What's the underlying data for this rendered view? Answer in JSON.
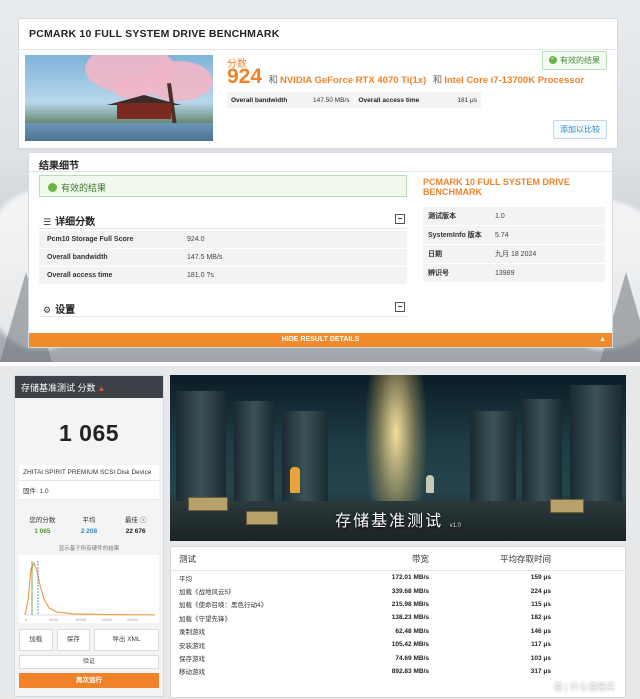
{
  "top": {
    "title": "PCMARK 10 FULL SYSTEM DRIVE BENCHMARK",
    "score_label": "分数",
    "score": "924",
    "and1": "和",
    "gpu": "NVIDIA GeForce RTX 4070 Ti(1x)",
    "and2": "和",
    "cpu": "Intel Core i7-13700K Processor",
    "valid_pill": "有效的结果",
    "metrics": [
      {
        "label": "Overall bandwidth",
        "value": "147.50 MB/s"
      },
      {
        "label": "Overall access time",
        "value": "181 μs"
      }
    ],
    "compare_button": "添加以比较",
    "details_heading": "结果细节",
    "valid_banner": "有效的结果",
    "score_section": "详细分数",
    "score_rows": [
      {
        "k": "Pcm10 Storage Full Score",
        "v": "924.0"
      },
      {
        "k": "Overall bandwidth",
        "v": "147.5 MB/s"
      },
      {
        "k": "Overall access time",
        "v": "181.0 ?s"
      }
    ],
    "settings_section": "设置",
    "right_title": "PCMARK 10 FULL SYSTEM DRIVE BENCHMARK",
    "right_rows": [
      {
        "k": "测试版本",
        "v": "1.0"
      },
      {
        "k": "SystemInfo 版本",
        "v": "5.74"
      },
      {
        "k": "日期",
        "v": "九月 18 2024"
      },
      {
        "k": "辨识号",
        "v": "13989"
      }
    ],
    "hide_bar": "HIDE RESULT DETAILS"
  },
  "bottom": {
    "header": "存储基准测试 分数",
    "big_score": "1 065",
    "device": "ZHITAI SPIRIT PREMIUM SCSI Disk Device",
    "version_line": "固件: 1.0",
    "compare": [
      {
        "label": "您的分数",
        "value": "1 065",
        "color": "#4a9a2e"
      },
      {
        "label": "平均",
        "value": "2 208",
        "color": "#2e86c1"
      },
      {
        "label": "最佳 ⓘ",
        "value": "22 676",
        "color": "#222222"
      }
    ],
    "show_all": "显示基于所有硬件的结果",
    "buttons": [
      "加载",
      "保存",
      "导出 XML"
    ],
    "verify": "验证",
    "run_again": "再次运行",
    "scene_title": "存储基准测试",
    "scene_version": "v1.0",
    "table_headers": [
      "测试",
      "带宽",
      "平均存取时间"
    ],
    "table_rows": [
      [
        "平均",
        "172.01 MB/s",
        "159 μs"
      ],
      [
        "加载《战地风云5》",
        "339.68 MB/s",
        "224 μs"
      ],
      [
        "加载《使命召唤：黑色行动4》",
        "215.98 MB/s",
        "115 μs"
      ],
      [
        "加载《守望先锋》",
        "138.23 MB/s",
        "182 μs"
      ],
      [
        "录制游戏",
        "62.48 MB/s",
        "146 μs"
      ],
      [
        "安装游戏",
        "105.42 MB/s",
        "117 μs"
      ],
      [
        "保存游戏",
        "74.69 MB/s",
        "103 μs"
      ],
      [
        "移动游戏",
        "892.83 MB/s",
        "317 μs"
      ]
    ],
    "watermark": "值 | 什么值得买"
  },
  "colors": {
    "accent": "#f0832a",
    "valid_green": "#6cb544",
    "link_blue": "#2e86c1"
  }
}
